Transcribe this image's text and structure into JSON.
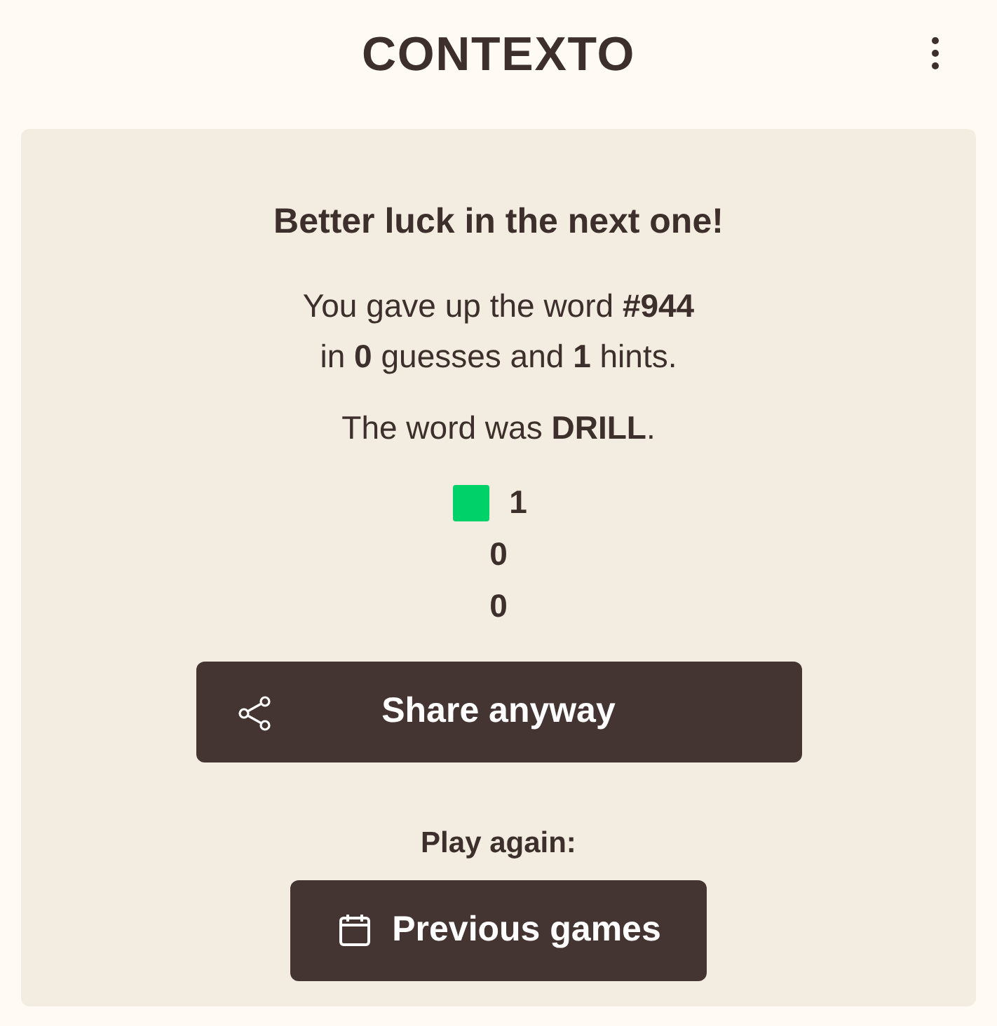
{
  "header": {
    "title": "CONTEXTO"
  },
  "result": {
    "heading": "Better luck in the next one!",
    "summary": "You gave up the word **#944**\nin **0** guesses and **1** hints.",
    "answer": "The word was **DRILL**.",
    "stats": [
      {
        "color": "#00d26a",
        "count": "1"
      },
      {
        "count": "0"
      },
      {
        "count": "0"
      }
    ],
    "share_button": "Share anyway",
    "play_again_label": "Play again:",
    "previous_button": "Previous games"
  }
}
